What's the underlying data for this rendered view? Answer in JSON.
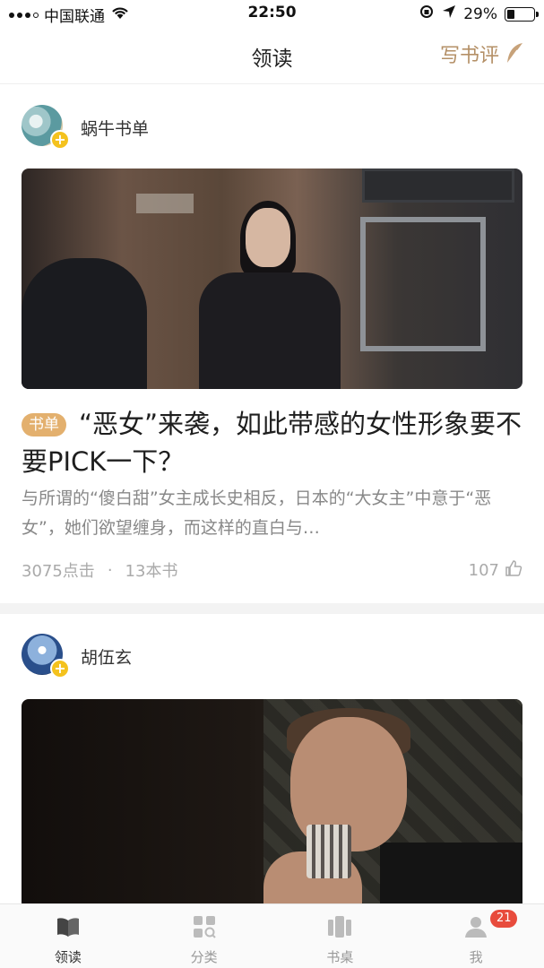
{
  "status_bar": {
    "carrier": "中国联通",
    "time": "22:50",
    "battery": "29%",
    "battery_level": 0.29
  },
  "nav": {
    "title": "领读",
    "write_review": "写书评"
  },
  "feed": [
    {
      "author": "蜗牛书单",
      "tag": "书单",
      "title": "“恶女”来袭，如此带感的女性形象要不要PICK一下？",
      "summary": "与所谓的“傻白甜”女主成长史相反，日本的“大女主”中意于“恶女”，她们欲望缠身，而这样的直白与…",
      "clicks": "3075点击",
      "books": "13本书",
      "likes": "107"
    },
    {
      "author": "胡伍玄"
    }
  ],
  "tabs": [
    {
      "label": "领读",
      "icon": "book-open-icon",
      "active": true
    },
    {
      "label": "分类",
      "icon": "grid-search-icon",
      "active": false
    },
    {
      "label": "书桌",
      "icon": "bookshelf-icon",
      "active": false
    },
    {
      "label": "我",
      "icon": "user-icon",
      "active": false,
      "badge": "21"
    }
  ],
  "colors": {
    "accent": "#b49067",
    "tag": "#e3b06e",
    "badge": "#e84b3c",
    "follow": "#f4c21e"
  }
}
